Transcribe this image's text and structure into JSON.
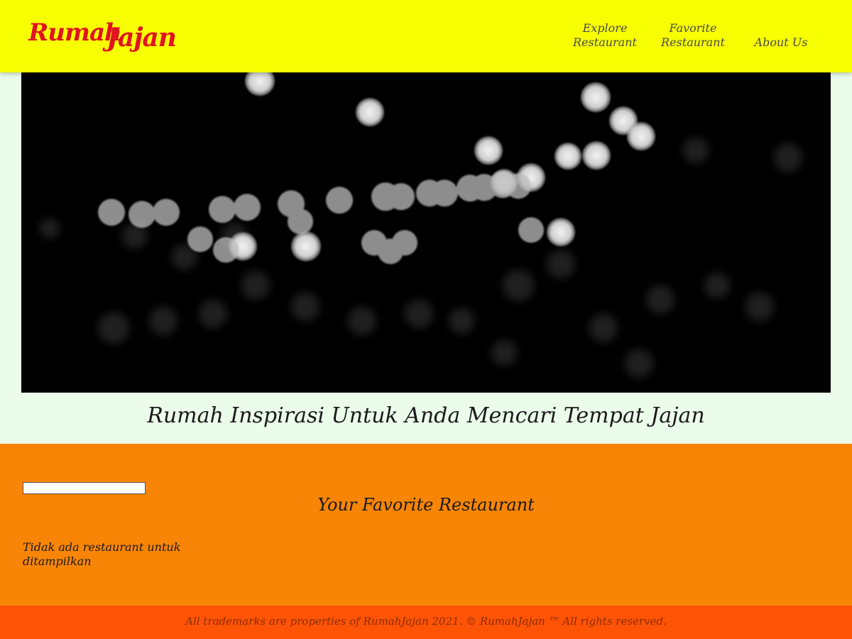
{
  "header": {
    "logo_word1": "Rumah",
    "logo_word2": "Jajan",
    "nav": [
      {
        "line1": "Explore",
        "line2": "Restaurant"
      },
      {
        "line1": "Favorite",
        "line2": "Restaurant"
      },
      {
        "label": "About Us"
      }
    ]
  },
  "hero": {
    "tagline": "Rumah Inspirasi Untuk Anda Mencari Tempat Jajan"
  },
  "main": {
    "search": {
      "value": "",
      "placeholder": ""
    },
    "title": "Your Favorite Restaurant",
    "empty_message": "Tidak ada restaurant untuk ditampilkan"
  },
  "footer": {
    "text": "All trademarks are properties of RumahJajan 2021. © RumahJajan ™ All rights reserved."
  },
  "colors": {
    "header_bg": "#f7ff02",
    "logo": "#e0141e",
    "page_bg": "#ebfcea",
    "main_bg": "#f88505",
    "footer_bg": "#ff5306"
  }
}
